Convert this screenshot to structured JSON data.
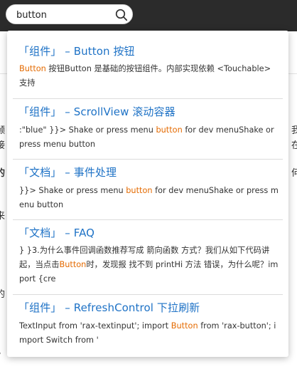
{
  "search": {
    "value": "button",
    "placeholder": ""
  },
  "icons": {
    "search": "search-icon"
  },
  "colors": {
    "topbar": "#2b2b2b",
    "title_link": "#1e72c6",
    "highlight": "#e46a00"
  },
  "background_page": {
    "left_fragments": [
      "颡",
      "接",
      "的",
      "来",
      "的",
      "。"
    ],
    "right_fragments": [
      "我",
      "在",
      "何"
    ]
  },
  "results": [
    {
      "title": "「组件」 – Button 按钮",
      "snippet": [
        {
          "t": "Button",
          "hl": true
        },
        {
          "t": " 按钮Button 是基础的按钮组件。内部实现依赖 <Touchable> 支持",
          "hl": false
        }
      ]
    },
    {
      "title": "「组件」 – ScrollView 滚动容器",
      "snippet": [
        {
          "t": ":\"blue\" }}> Shake or press menu ",
          "hl": false
        },
        {
          "t": "button",
          "hl": true
        },
        {
          "t": " for dev menuShake or press menu button",
          "hl": false
        }
      ]
    },
    {
      "title": "「文档」 – 事件处理",
      "snippet": [
        {
          "t": "}}> Shake or press menu ",
          "hl": false
        },
        {
          "t": "button",
          "hl": true
        },
        {
          "t": " for dev menuShake or press menu button",
          "hl": false
        }
      ]
    },
    {
      "title": "「文档」 – FAQ",
      "snippet": [
        {
          "t": "} }3.为什么事件回调函数推荐写成 箭向函数 方式？我们从如下代码讲起，当点击",
          "hl": false
        },
        {
          "t": "Button",
          "hl": true
        },
        {
          "t": "时，发现报 找不到 printHi 方法 错误，为什么呢？import {cre",
          "hl": false
        }
      ]
    },
    {
      "title": "「组件」 – RefreshControl 下拉刷新",
      "snippet": [
        {
          "t": "TextInput from 'rax-textinput'; import ",
          "hl": false
        },
        {
          "t": "Button",
          "hl": true
        },
        {
          "t": " from 'rax-button'; import Switch from '",
          "hl": false
        }
      ]
    }
  ]
}
